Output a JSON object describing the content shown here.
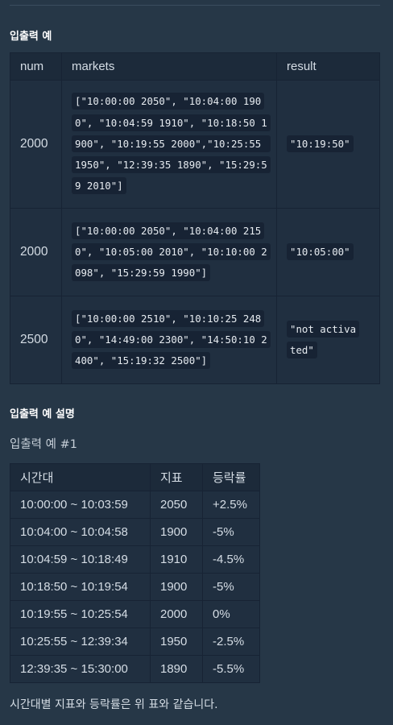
{
  "section_io": {
    "title": "입출력 예"
  },
  "io_table": {
    "headers": [
      "num",
      "markets",
      "result"
    ],
    "rows": [
      {
        "num": "2000",
        "markets": "[\"10:00:00 2050\", \"10:04:00 1900\", \"10:04:59 1910\", \"10:18:50 1900\", \"10:19:55 2000\",\"10:25:55 1950\", \"12:39:35 1890\", \"15:29:59 2010\"]",
        "result": "\"10:19:50\""
      },
      {
        "num": "2000",
        "markets": "[\"10:00:00 2050\", \"10:04:00 2150\", \"10:05:00 2010\", \"10:10:00 2098\", \"15:29:59 1990\"]",
        "result": "\"10:05:00\""
      },
      {
        "num": "2500",
        "markets": "[\"10:00:00 2510\", \"10:10:25 2480\", \"14:49:00 2300\", \"14:50:10 2400\", \"15:19:32 2500\"]",
        "result": "\"not activated\""
      }
    ]
  },
  "section_explain": {
    "title": "입출력 예 설명"
  },
  "example1": {
    "title": "입출력 예 #1",
    "headers": [
      "시간대",
      "지표",
      "등락률"
    ],
    "rows": [
      [
        "10:00:00 ~ 10:03:59",
        "2050",
        "+2.5%"
      ],
      [
        "10:04:00 ~ 10:04:58",
        "1900",
        "-5%"
      ],
      [
        "10:04:59 ~ 10:18:49",
        "1910",
        "-4.5%"
      ],
      [
        "10:18:50 ~ 10:19:54",
        "1900",
        "-5%"
      ],
      [
        "10:19:55 ~ 10:25:54",
        "2000",
        "0%"
      ],
      [
        "10:25:55 ~ 12:39:34",
        "1950",
        "-2.5%"
      ],
      [
        "12:39:35 ~ 15:30:00",
        "1890",
        "-5.5%"
      ]
    ],
    "note": "시간대별 지표와 등락률은 위 표와 같습니다."
  }
}
